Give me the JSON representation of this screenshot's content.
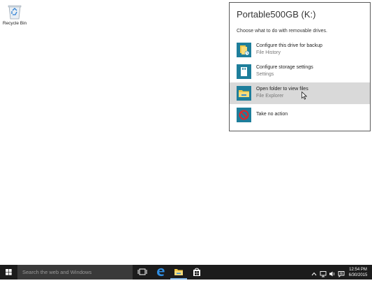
{
  "desktop": {
    "recycle_bin_label": "Recycle Bin"
  },
  "autoplay": {
    "title": "Portable500GB (K:)",
    "subtitle": "Choose what to do with removable drives.",
    "options": [
      {
        "label": "Configure this drive for backup",
        "sublabel": "File History",
        "icon": "file-history-icon"
      },
      {
        "label": "Configure storage settings",
        "sublabel": "Settings",
        "icon": "storage-settings-icon"
      },
      {
        "label": "Open folder to view files",
        "sublabel": "File Explorer",
        "icon": "file-explorer-icon",
        "highlighted": true
      },
      {
        "label": "Take no action",
        "sublabel": "",
        "icon": "no-action-icon"
      }
    ]
  },
  "taskbar": {
    "search_placeholder": "Search the web and Windows",
    "apps": [
      "task-view-icon",
      "edge-icon",
      "file-explorer-icon",
      "store-icon"
    ],
    "tray_icons": [
      "chevron-up-icon",
      "network-icon",
      "volume-icon",
      "keyboard-icon",
      "action-center-icon"
    ],
    "time": "12:54 PM",
    "date": "6/30/2015"
  },
  "colors": {
    "accent": "#1e7e9b",
    "taskbar": "#1c1c1c",
    "highlight": "#d9d9d9"
  }
}
